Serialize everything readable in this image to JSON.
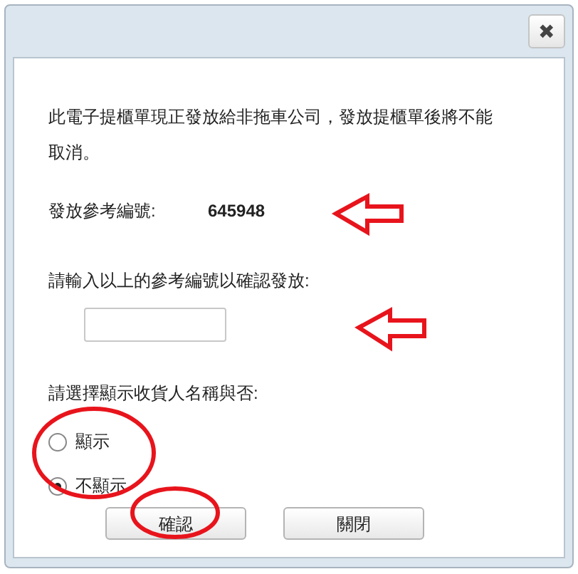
{
  "close_button": {
    "label": "✖"
  },
  "message": "此電子提櫃單現正發放給非拖車公司，發放提櫃單後將不能取消。",
  "reference": {
    "label": "發放參考編號:",
    "value": "645948"
  },
  "confirm_input": {
    "label": "請輸入以上的參考編號以確認發放:"
  },
  "show_consignee": {
    "label": "請選擇顯示收貨人名稱與否:",
    "options": [
      {
        "label": "顯示",
        "selected": false
      },
      {
        "label": "不顯示",
        "selected": true
      }
    ]
  },
  "buttons": [
    {
      "label": "確認"
    },
    {
      "label": "關閉"
    }
  ]
}
